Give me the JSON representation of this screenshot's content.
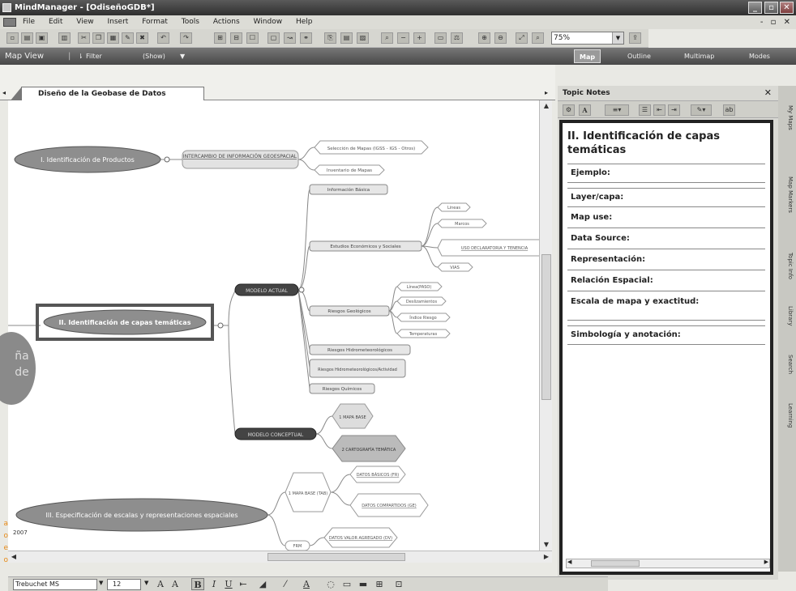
{
  "window": {
    "title": "MindManager - [OdiseñoGDB*]",
    "minimize": "_",
    "maximize": "▫",
    "close": "✕"
  },
  "menu": {
    "items": [
      "File",
      "Edit",
      "View",
      "Insert",
      "Format",
      "Tools",
      "Actions",
      "Window",
      "Help"
    ],
    "mdi_controls": "- ▫ ✕"
  },
  "toolbar": {
    "zoom": "75%"
  },
  "viewbar": {
    "title": "Map View",
    "filter": "Filter",
    "show": "(Show)",
    "tabs": [
      "Map",
      "Outline",
      "Multimap",
      "Modes"
    ]
  },
  "document_tab": {
    "label": "Diseño de la Geobase de Datos"
  },
  "mindmap": {
    "central_fragment": "ña\nde",
    "main_topics": [
      "I. Identificación de Productos",
      "II. Identificación de capas temáticas",
      "III. Especificación de escalas y representaciones espaciales"
    ],
    "topic1_children": [
      "INTERCAMBIO DE INFORMACIÓN GEOESPACIAL"
    ],
    "topic1_leaves": [
      "Selección de Mapas (IGSS - IGS - Otros)",
      "Inventario de Mapas"
    ],
    "actual_model": "MODELO ACTUAL",
    "conceptual_model": "MODELO CONCEPTUAL",
    "actual_children": [
      "Información Básica",
      "Estudios Económicos y Sociales",
      "Riesgos Geológicos",
      "Riesgos Hidrometeorológicos",
      "Riesgos Hidrometeorológicos/Actividad",
      "Riesgos Químicos"
    ],
    "econ_leaves": [
      "Lineas",
      "Marcos",
      "USO DECLARATORIA Y TENENCIA",
      "VIAS"
    ],
    "geo_leaves": [
      "Línea(PASO)",
      "Deslizamientos",
      "Índice Riesgo",
      "Temperaturas"
    ],
    "conceptual_children": [
      "1 MAPA BASE",
      "2 CARTOGRAFÍA TEMÁTICA"
    ],
    "topic3_children": [
      "1 MAPA BASE (TAB)",
      "FRM"
    ],
    "topic3_leaves": [
      "DATOS BÁSICOS (FR)",
      "DATOS COMPARTIDOS (GE)",
      "DATOS VALOR AGREGADO (DV)"
    ],
    "year_fragment": "2007"
  },
  "topic_notes": {
    "header": "Topic Notes",
    "title": "II. Identificación de capas temáticas",
    "rows": [
      "Ejemplo:",
      "Layer/capa:",
      "Map use:",
      "Data Source:",
      "Representación:",
      "Relación Espacial:",
      "Escala de mapa y exactitud:",
      "Simbología y anotación:"
    ]
  },
  "side_tabs": [
    "My Maps",
    "Map Markers",
    "Topic Info",
    "Library",
    "Search",
    "Learning"
  ],
  "format_bar": {
    "font": "Trebuchet MS",
    "size": "12"
  },
  "left_edge_fragment": "a\no\ne\no"
}
